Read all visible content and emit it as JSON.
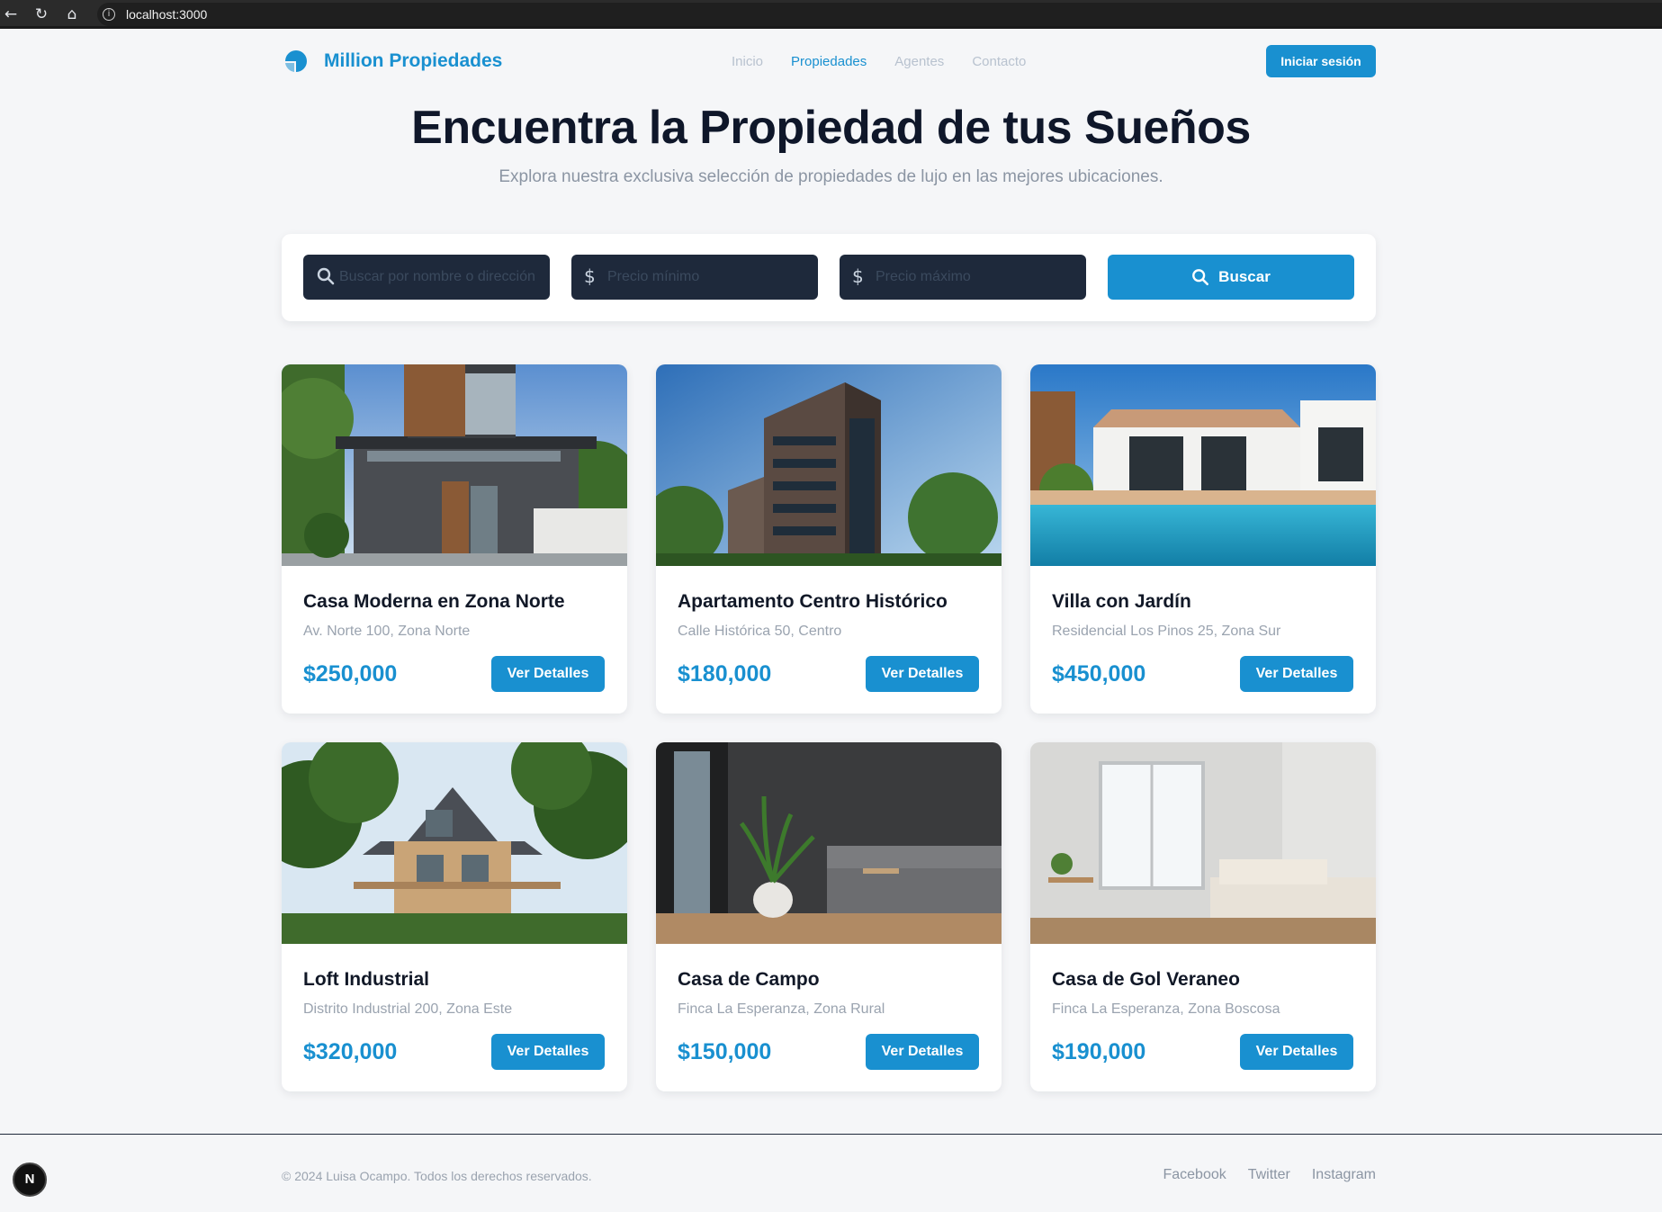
{
  "browser": {
    "url": "localhost:3000",
    "back_icon": "arrow-left-icon",
    "reload_icon": "reload-icon",
    "home_icon": "home-icon"
  },
  "header": {
    "brand": "Million Propiedades",
    "nav": [
      {
        "label": "Inicio",
        "active": false
      },
      {
        "label": "Propiedades",
        "active": true
      },
      {
        "label": "Agentes",
        "active": false
      },
      {
        "label": "Contacto",
        "active": false
      }
    ],
    "login_label": "Iniciar sesión"
  },
  "hero": {
    "title": "Encuentra la Propiedad de tus Sueños",
    "subtitle": "Explora nuestra exclusiva selección de propiedades de lujo en las mejores ubicaciones."
  },
  "search": {
    "name_placeholder": "Buscar por nombre o dirección",
    "min_price_placeholder": "Precio mínimo",
    "max_price_placeholder": "Precio máximo",
    "button_label": "Buscar"
  },
  "properties": [
    {
      "title": "Casa Moderna en Zona Norte",
      "address": "Av. Norte 100, Zona Norte",
      "price": "$250,000",
      "button": "Ver Detalles"
    },
    {
      "title": "Apartamento Centro Histórico",
      "address": "Calle Histórica 50, Centro",
      "price": "$180,000",
      "button": "Ver Detalles"
    },
    {
      "title": "Villa con Jardín",
      "address": "Residencial Los Pinos 25, Zona Sur",
      "price": "$450,000",
      "button": "Ver Detalles"
    },
    {
      "title": "Loft Industrial",
      "address": "Distrito Industrial 200, Zona Este",
      "price": "$320,000",
      "button": "Ver Detalles"
    },
    {
      "title": "Casa de Campo",
      "address": "Finca La Esperanza, Zona Rural",
      "price": "$150,000",
      "button": "Ver Detalles"
    },
    {
      "title": "Casa de Gol Veraneo",
      "address": "Finca La Esperanza, Zona Boscosa",
      "price": "$190,000",
      "button": "Ver Detalles"
    }
  ],
  "footer": {
    "copyright": "© 2024 Luisa Ocampo. Todos los derechos reservados.",
    "links": [
      "Facebook",
      "Twitter",
      "Instagram"
    ]
  },
  "dev_badge": "N",
  "colors": {
    "accent": "#1990d0",
    "dark_field": "#1e293b",
    "background": "#f5f6f8"
  }
}
